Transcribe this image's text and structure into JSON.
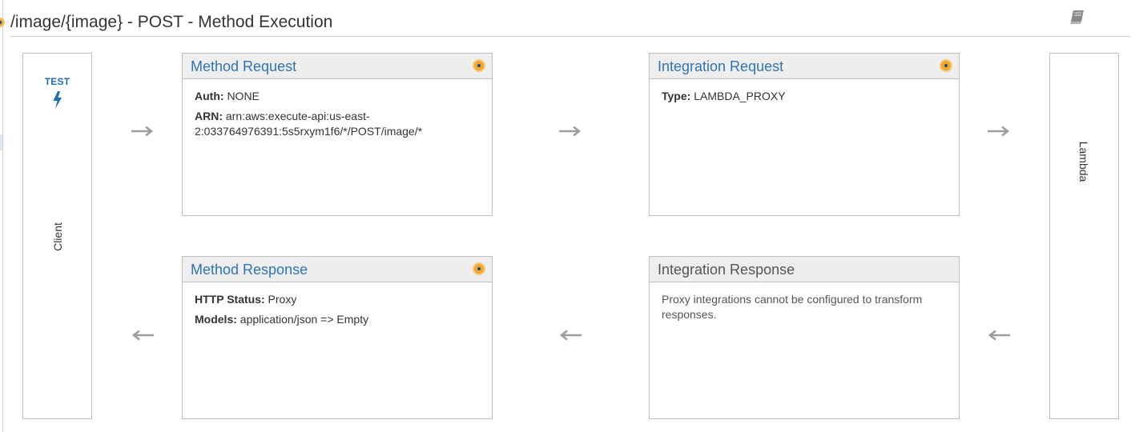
{
  "page": {
    "title": "/image/{image} - POST - Method Execution",
    "docs_icon": "book-icon"
  },
  "client": {
    "test_label": "TEST",
    "test_icon": "lightning-bolt-icon",
    "label": "Client"
  },
  "lambda": {
    "label": "Lambda"
  },
  "method_request": {
    "title": "Method Request",
    "status_icon": "status-indicator-icon",
    "fields": [
      {
        "key": "Auth:",
        "value": "NONE"
      },
      {
        "key": "ARN:",
        "value": "arn:aws:execute-api:us-east-2:033764976391:5s5rxym1f6/*/POST/image/*"
      }
    ]
  },
  "integration_request": {
    "title": "Integration Request",
    "status_icon": "status-indicator-icon",
    "fields": [
      {
        "key": "Type:",
        "value": "LAMBDA_PROXY"
      }
    ]
  },
  "method_response": {
    "title": "Method Response",
    "status_icon": "status-indicator-icon",
    "fields": [
      {
        "key": "HTTP Status:",
        "value": "Proxy"
      },
      {
        "key": "Models:",
        "value": "application/json => Empty"
      }
    ]
  },
  "integration_response": {
    "title": "Integration Response",
    "note": "Proxy integrations cannot be configured to transform responses."
  },
  "colors": {
    "link_blue": "#2f74b5",
    "header_bg": "#eeeeee",
    "border": "#bfbfbf",
    "status_orange": "#f3a52d",
    "arrow_gray": "#9e9e9e"
  }
}
